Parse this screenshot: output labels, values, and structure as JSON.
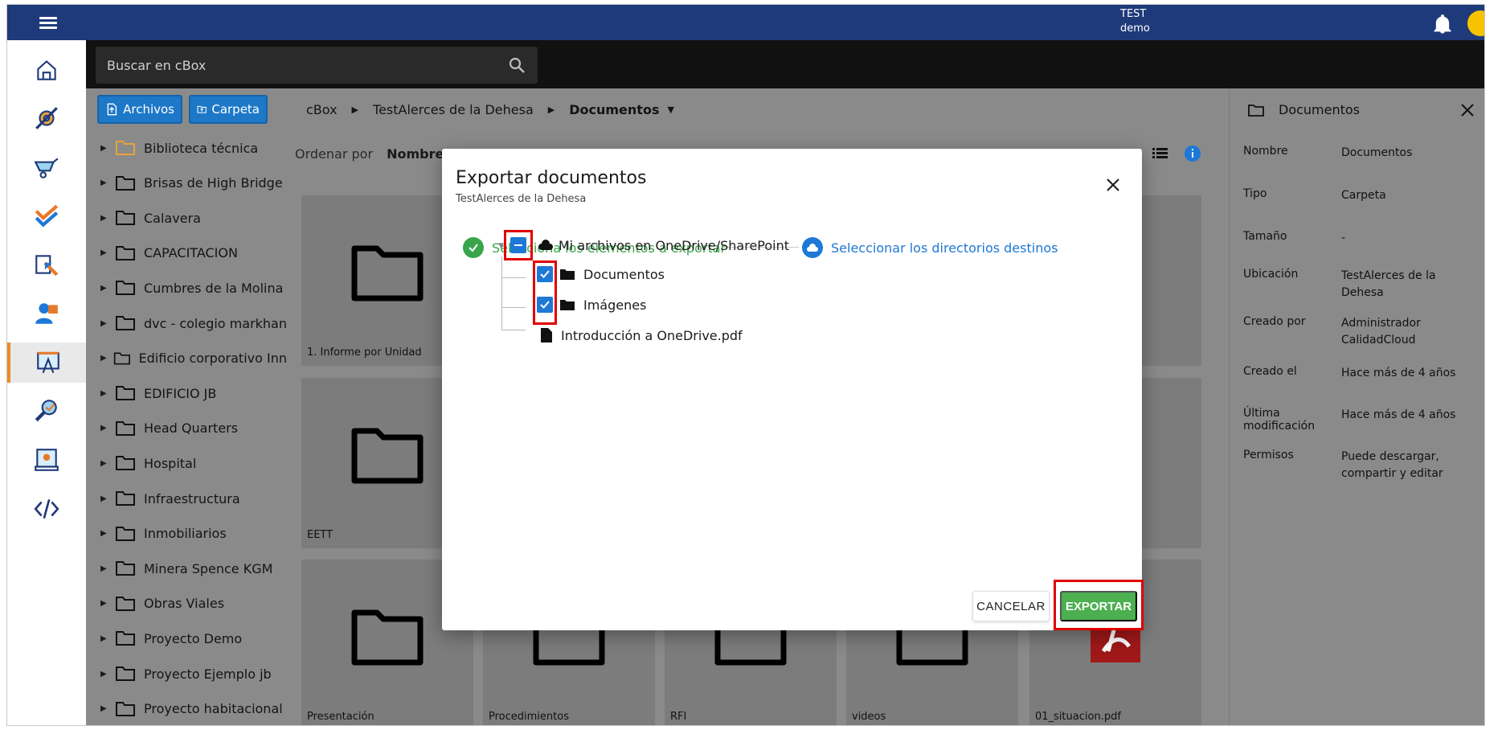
{
  "colors": {
    "topbar": "#1f3a7a",
    "accent_blue": "#1e78d6",
    "success_green": "#3aa44a",
    "export_green": "#4caf50",
    "active_rail": "#f08a24",
    "avatar": "#f7c300",
    "highlight_red": "#e00000"
  },
  "header": {
    "user_line1": "TEST",
    "user_line2": "demo"
  },
  "search": {
    "placeholder": "Buscar en cBox"
  },
  "toolbar": {
    "upload_files": "Archivos",
    "upload_folder": "Carpeta"
  },
  "rail": {
    "icons": [
      "home-icon",
      "settings-icon",
      "wheelbarrow-icon",
      "checklist-icon",
      "export-icon",
      "users-icon",
      "plans-icon",
      "inspect-icon",
      "certificate-icon",
      "code-icon"
    ]
  },
  "tree": {
    "items": [
      "Biblioteca técnica",
      "Brisas de High Bridge",
      "Calavera",
      "CAPACITACION",
      "Cumbres de la Molina",
      "dvc - colegio markhan",
      "Edificio corporativo Inn",
      "EDIFICIO JB",
      "Head Quarters",
      "Hospital",
      "Infraestructura",
      "Inmobiliarios",
      "Minera Spence KGM",
      "Obras Viales",
      "Proyecto Demo",
      "Proyecto Ejemplo jb",
      "Proyecto habitacional"
    ]
  },
  "breadcrumb": {
    "root": "cBox",
    "project": "TestAlerces de la Dehesa",
    "current": "Documentos"
  },
  "sort": {
    "label": "Ordenar por",
    "value": "Nombre"
  },
  "cards": {
    "row1_label": "1. Informe por Unidad",
    "row2_label": "EETT",
    "row3": [
      "Presentación",
      "Procedimientos",
      "RFI",
      "videos",
      "01_situacion.pdf"
    ]
  },
  "info": {
    "title": "Documentos",
    "rows": [
      {
        "key": "Nombre",
        "value": "Documentos"
      },
      {
        "key": "Tipo",
        "value": "Carpeta"
      },
      {
        "key": "Tamaño",
        "value": "-"
      },
      {
        "key": "Ubicación",
        "value": "TestAlerces de la Dehesa"
      },
      {
        "key": "Creado por",
        "value": "Administrador CalidadCloud"
      },
      {
        "key": "Creado el",
        "value": "Hace más de 4 años"
      },
      {
        "key": "Última modificación",
        "value": "Hace más de 4 años"
      },
      {
        "key": "Permisos",
        "value": "Puede descargar, compartir y editar"
      }
    ]
  },
  "modal": {
    "title": "Exportar documentos",
    "subtitle": "TestAlerces de la Dehesa",
    "step1": "Selecciona los elementos a exportar",
    "step2": "Seleccionar los directorios destinos",
    "tree_root": "Mi archivos en OneDrive/SharePoint",
    "tree_children": [
      "Documentos",
      "Imágenes",
      "Introducción a OneDrive.pdf"
    ],
    "cancel": "CANCELAR",
    "export": "EXPORTAR"
  }
}
